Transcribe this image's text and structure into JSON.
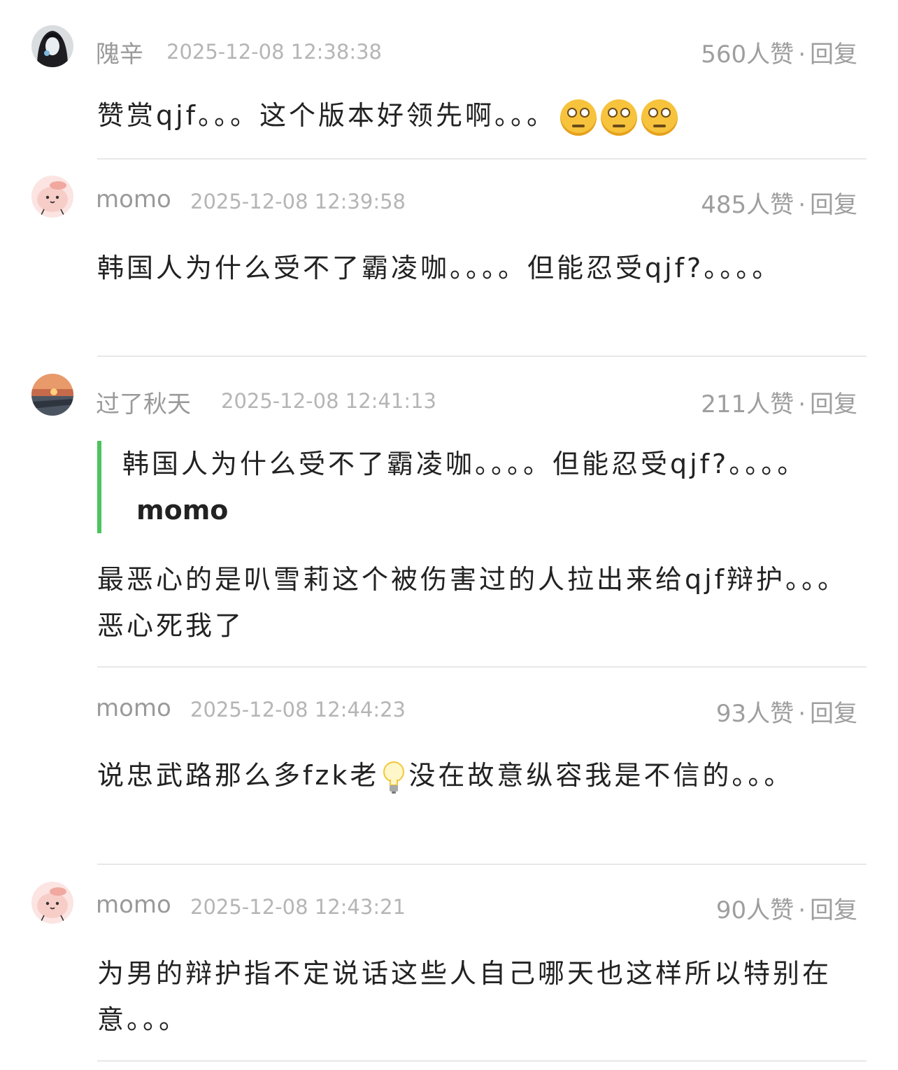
{
  "comments": [
    {
      "user": "隗辛",
      "time": "2025-12-08 12:38:38",
      "likes": "560人赞",
      "dot": "·",
      "reply": "回复",
      "text_a": "赞赏qjf。。。这个版本好领先啊。。。",
      "emoji": [
        "eye-roll-emoji",
        "eye-roll-emoji",
        "eye-roll-emoji"
      ]
    },
    {
      "user": "momo",
      "time": "2025-12-08 12:39:58",
      "likes": "485人赞",
      "dot": "·",
      "reply": "回复",
      "text_a": "韩国人为什么受不了霸凌咖。。。。但能忍受qjf?。。。。"
    },
    {
      "user": "过了秋天",
      "time": "2025-12-08 12:41:13",
      "likes": "211人赞",
      "dot": "·",
      "reply": "回复",
      "quote_text": "韩国人为什么受不了霸凌咖。。。。但能忍受qjf?。。。。",
      "quote_user": "momo",
      "text_a": "最恶心的是叭雪莉这个被伤害过的人拉出来给qjf辩护。。。恶心死我了"
    },
    {
      "user": "momo",
      "time": "2025-12-08 12:44:23",
      "likes": "93人赞",
      "dot": "·",
      "reply": "回复",
      "text_a": "说忠武路那么多fzk老",
      "icon": "light-bulb-emoji",
      "text_b": "没在故意纵容我是不信的。。。"
    },
    {
      "user": "momo",
      "time": "2025-12-08 12:43:21",
      "likes": "90人赞",
      "dot": "·",
      "reply": "回复",
      "text_a": "为男的辩护指不定说话这些人自己哪天也这样所以特别在意。。。"
    }
  ]
}
